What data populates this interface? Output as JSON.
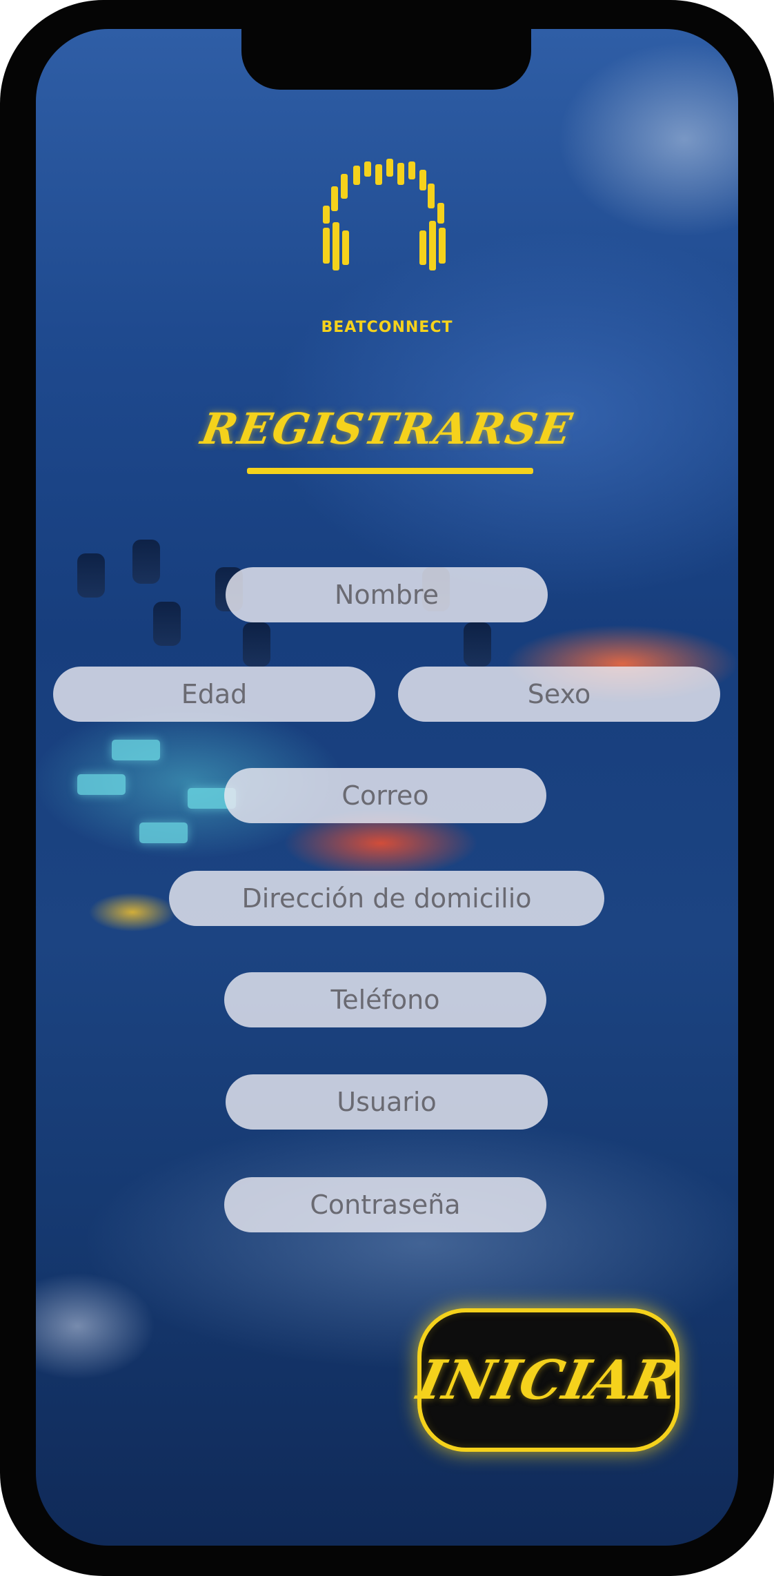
{
  "app": {
    "brand": "BEATCONNECT",
    "logo_icon": "headphones-equalizer-icon"
  },
  "page": {
    "title": "Registrarse"
  },
  "form": {
    "nombre_placeholder": "Nombre",
    "edad_placeholder": "Edad",
    "sexo_placeholder": "Sexo",
    "correo_placeholder": "Correo",
    "direccion_placeholder": "Dirección de domicilio",
    "telefono_placeholder": "Teléfono",
    "usuario_placeholder": "Usuario",
    "contrasena_placeholder": "Contraseña"
  },
  "actions": {
    "submit_label": "INICIAR"
  },
  "colors": {
    "accent": "#f5d21c",
    "frame": "#050505",
    "field_bg": "#e8e8f0",
    "field_text": "#6a6a72"
  }
}
